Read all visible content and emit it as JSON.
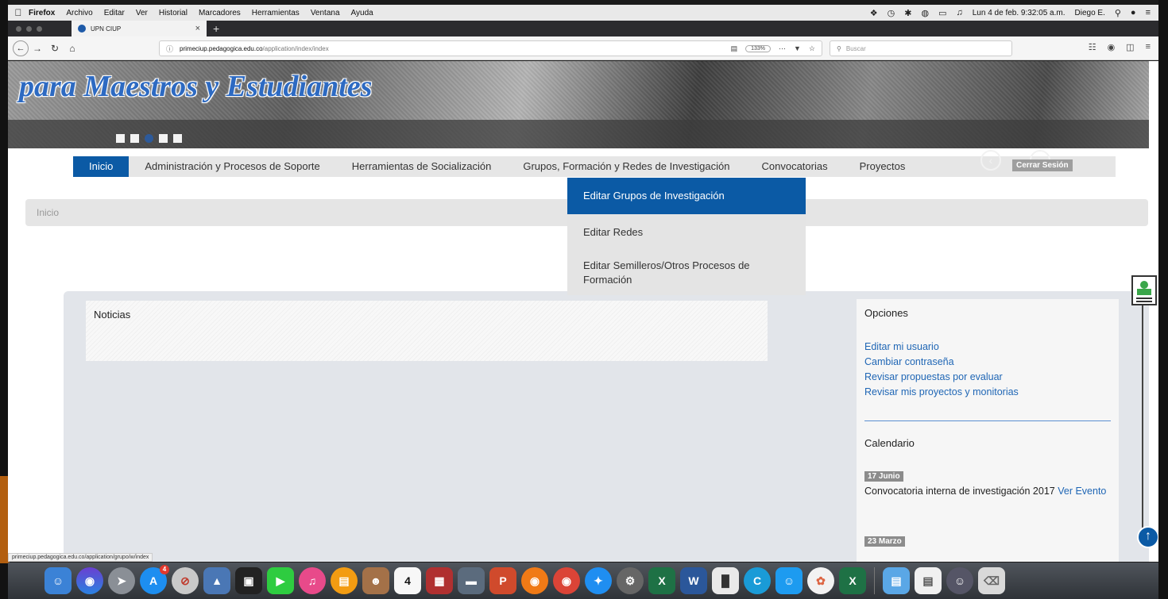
{
  "menubar": {
    "app": "Firefox",
    "items": [
      "Archivo",
      "Editar",
      "Ver",
      "Historial",
      "Marcadores",
      "Herramientas",
      "Ventana",
      "Ayuda"
    ],
    "datetime": "Lun 4 de feb. 9:32:05 a.m.",
    "user": "Diego E."
  },
  "browser": {
    "tab_title": "UPN CIUP",
    "url_host": "primeciup.pedagogica.edu.co",
    "url_path": "/application/index/index",
    "zoom": "133%",
    "search_placeholder": "Buscar",
    "status_url": "primeciup.pedagogica.edu.co/application/grupo/w/index"
  },
  "banner": {
    "title": "para Maestros y Estudiantes"
  },
  "mainnav": {
    "items": [
      "Inicio",
      "Administración y Procesos de Soporte",
      "Herramientas de Socialización",
      "Grupos, Formación y Redes de Investigación",
      "Convocatorias",
      "Proyectos"
    ],
    "logout": "Cerrar Sesión"
  },
  "dropdown": {
    "items": [
      "Editar Grupos de Investigación",
      "Editar Redes",
      "Editar Semilleros/Otros Procesos de Formación"
    ]
  },
  "breadcrumb": "Inicio",
  "news": {
    "title": "Noticias"
  },
  "options": {
    "title": "Opciones",
    "links": [
      "Editar mi usuario",
      "Cambiar contraseña",
      "Revisar propuestas por evaluar",
      "Revisar mis proyectos y monitorias"
    ],
    "calendar_title": "Calendario",
    "event_date": "17 Junio",
    "event_text": "Convocatoria interna de investigación 2017",
    "event_link": "Ver Evento",
    "next_date": "23 Marzo"
  },
  "dock": {
    "badge_count": "4",
    "calendar_day": "4"
  }
}
